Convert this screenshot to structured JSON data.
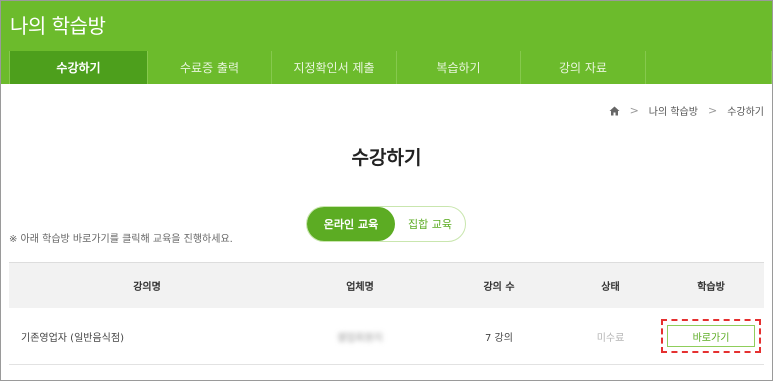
{
  "header": {
    "title": "나의 학습방"
  },
  "tabs": [
    {
      "label": "수강하기",
      "active": true
    },
    {
      "label": "수료증 출력",
      "active": false
    },
    {
      "label": "지정확인서 제출",
      "active": false
    },
    {
      "label": "복습하기",
      "active": false
    },
    {
      "label": "강의 자료",
      "active": false
    },
    {
      "label": "",
      "active": false
    }
  ],
  "breadcrumb": {
    "home_icon": "home-icon",
    "items": [
      "나의 학습방",
      "수강하기"
    ]
  },
  "page": {
    "title": "수강하기"
  },
  "notice": "※ 아래 학습방 바로가기를 클릭해 교육을 진행하세요.",
  "segment": {
    "online_label": "온라인 교육",
    "group_label": "집합 교육",
    "selected": "online"
  },
  "table": {
    "headers": [
      "강의명",
      "업체명",
      "강의 수",
      "상태",
      "학습방"
    ],
    "rows": [
      {
        "course": "기존영업자 (일반음식점)",
        "company": "셀업회원지",
        "lecture_count": "7 강의",
        "status": "미수료",
        "action": "바로가기"
      }
    ]
  },
  "colors": {
    "brand": "#6cbb2c",
    "active_tab": "#4d9f1c",
    "accent": "#5cac23",
    "highlight_border": "#e53030"
  }
}
